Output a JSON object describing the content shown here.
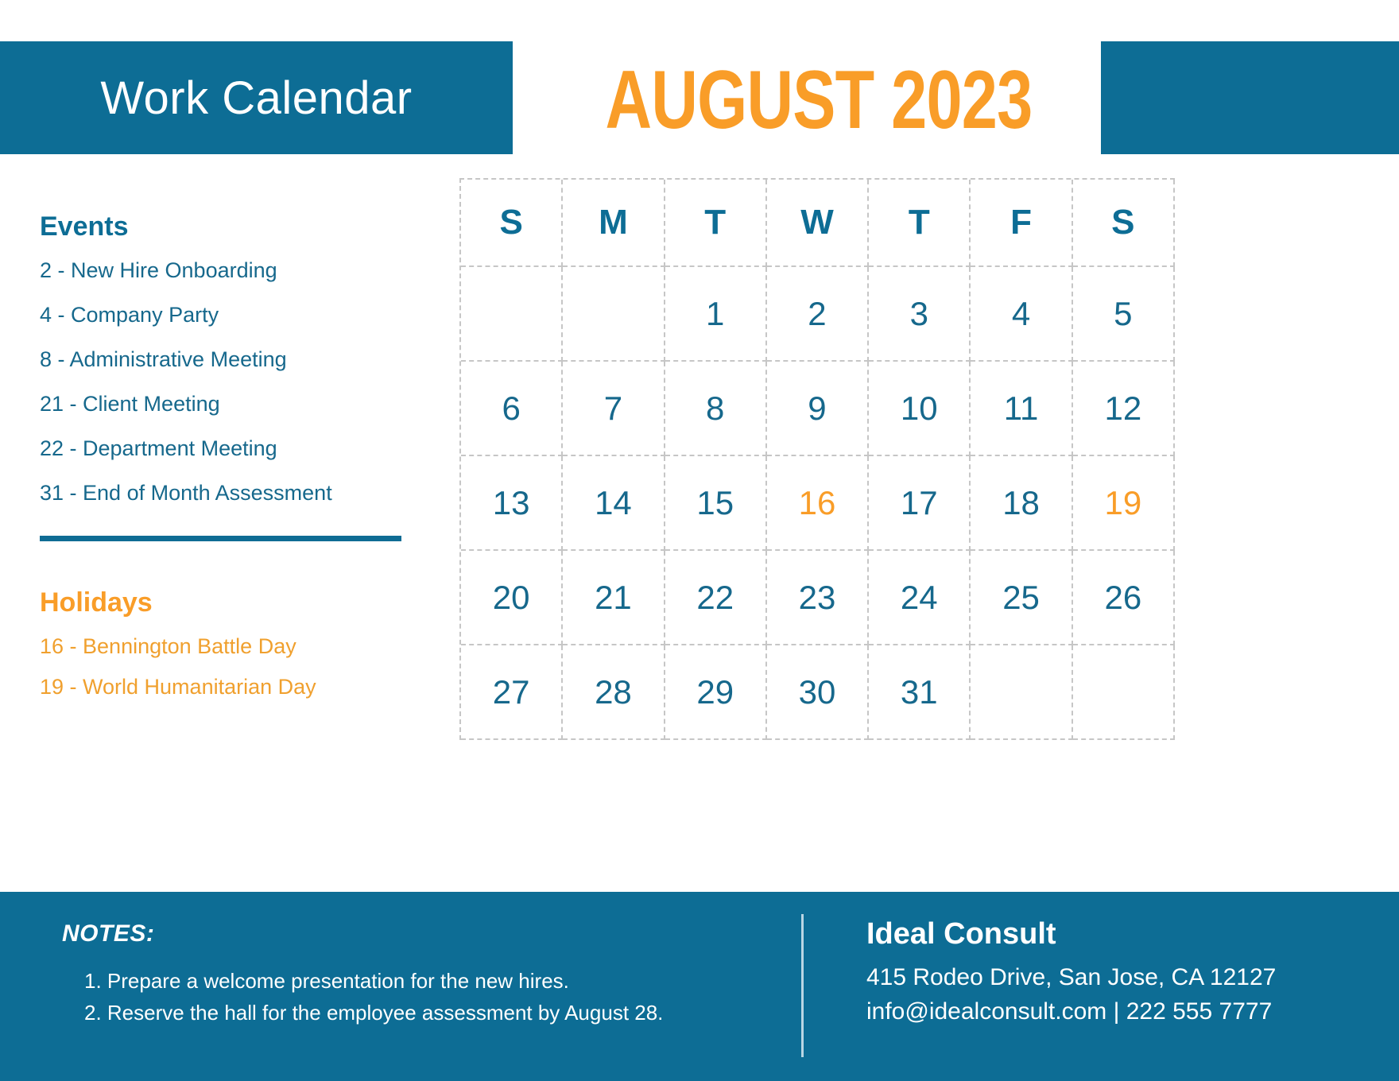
{
  "header": {
    "title": "Work Calendar",
    "month_year": "AUGUST 2023",
    "band_color": "#0d6d95",
    "month_color": "#f99d28"
  },
  "sidebar": {
    "events_heading": "Events",
    "events": [
      "2 - New Hire Onboarding",
      "4 - Company Party",
      "8 - Administrative Meeting",
      "21 - Client Meeting",
      "22 - Department Meeting",
      "31 - End of Month Assessment"
    ],
    "holidays_heading": "Holidays",
    "holidays": [
      "16 - Bennington Battle Day",
      "19 - World Humanitarian Day"
    ],
    "events_color": "#16688c",
    "holidays_color": "#f0a02e"
  },
  "calendar": {
    "weekday_headers": [
      "S",
      "M",
      "T",
      "W",
      "T",
      "F",
      "S"
    ],
    "highlight_days": [
      16,
      19
    ],
    "highlight_color": "#f99d28",
    "day_color": "#16688c",
    "weeks": [
      [
        "",
        "",
        "1",
        "2",
        "3",
        "4",
        "5"
      ],
      [
        "6",
        "7",
        "8",
        "9",
        "10",
        "11",
        "12"
      ],
      [
        "13",
        "14",
        "15",
        "16",
        "17",
        "18",
        "19"
      ],
      [
        "20",
        "21",
        "22",
        "23",
        "24",
        "25",
        "26"
      ],
      [
        "27",
        "28",
        "29",
        "30",
        "31",
        "",
        ""
      ]
    ]
  },
  "footer": {
    "notes_title": "NOTES:",
    "notes": [
      "1. Prepare a welcome presentation for the new hires.",
      "2. Reserve the hall for the employee assessment by August 28."
    ],
    "company_name": "Ideal Consult",
    "company_address": "415 Rodeo Drive, San Jose, CA 12127",
    "company_contact": "info@idealconsult.com | 222 555 7777",
    "background_color": "#0d6d95"
  }
}
